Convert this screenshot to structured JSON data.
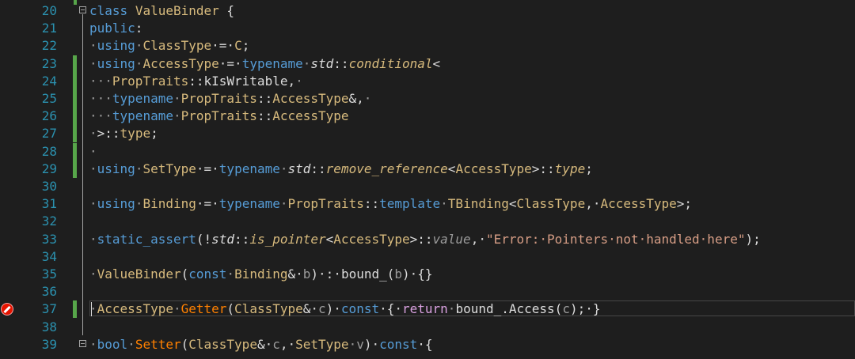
{
  "colors": {
    "background": "#1e1e1e",
    "line_number": "#2b91af",
    "change_bar": "#57a64a",
    "breakpoint": "#e51400",
    "keyword": "#569cd6",
    "type": "#4ec9b0",
    "string": "#d69d85",
    "function": "#dcdcaa"
  },
  "editor": {
    "lines": [
      {
        "num": "20",
        "tokens": [
          {
            "t": "class",
            "c": "t-kw"
          },
          {
            "t": " ",
            "c": "t-plain"
          },
          {
            "t": "ValueBinder",
            "c": "t-yellow"
          },
          {
            "t": " {",
            "c": "t-plain"
          }
        ]
      },
      {
        "num": "21",
        "tokens": [
          {
            "t": "public",
            "c": "t-kw"
          },
          {
            "t": ":",
            "c": "t-plain"
          }
        ]
      },
      {
        "num": "22",
        "tokens": [
          {
            "t": "·",
            "c": "t-gray"
          },
          {
            "t": "using",
            "c": "t-kw"
          },
          {
            "t": "·",
            "c": "t-gray"
          },
          {
            "t": "ClassType",
            "c": "t-yellow"
          },
          {
            "t": "·=·",
            "c": "t-plain"
          },
          {
            "t": "C",
            "c": "t-yellow"
          },
          {
            "t": ";",
            "c": "t-plain"
          }
        ]
      },
      {
        "num": "23",
        "tokens": [
          {
            "t": "·",
            "c": "t-gray"
          },
          {
            "t": "using",
            "c": "t-kw"
          },
          {
            "t": "·",
            "c": "t-gray"
          },
          {
            "t": "AccessType",
            "c": "t-yellow"
          },
          {
            "t": "·=·",
            "c": "t-plain"
          },
          {
            "t": "typename",
            "c": "t-kw"
          },
          {
            "t": "·",
            "c": "t-gray"
          },
          {
            "t": "std",
            "c": "t-ital"
          },
          {
            "t": "::",
            "c": "t-plain"
          },
          {
            "t": "conditional",
            "c": "t-ital t-yellow"
          },
          {
            "t": "<",
            "c": "t-plain"
          }
        ]
      },
      {
        "num": "24",
        "tokens": [
          {
            "t": "···",
            "c": "t-gray"
          },
          {
            "t": "PropTraits",
            "c": "t-yellow"
          },
          {
            "t": "::kIsWritable,",
            "c": "t-plain"
          },
          {
            "t": "·",
            "c": "t-gray"
          }
        ]
      },
      {
        "num": "25",
        "tokens": [
          {
            "t": "···",
            "c": "t-gray"
          },
          {
            "t": "typename",
            "c": "t-kw"
          },
          {
            "t": "·",
            "c": "t-gray"
          },
          {
            "t": "PropTraits",
            "c": "t-yellow"
          },
          {
            "t": "::",
            "c": "t-plain"
          },
          {
            "t": "AccessType",
            "c": "t-yellow"
          },
          {
            "t": "&,",
            "c": "t-plain"
          },
          {
            "t": "·",
            "c": "t-gray"
          }
        ]
      },
      {
        "num": "26",
        "tokens": [
          {
            "t": "···",
            "c": "t-gray"
          },
          {
            "t": "typename",
            "c": "t-kw"
          },
          {
            "t": "·",
            "c": "t-gray"
          },
          {
            "t": "PropTraits",
            "c": "t-yellow"
          },
          {
            "t": "::",
            "c": "t-plain"
          },
          {
            "t": "AccessType",
            "c": "t-yellow"
          }
        ]
      },
      {
        "num": "27",
        "tokens": [
          {
            "t": "·",
            "c": "t-gray"
          },
          {
            "t": ">::",
            "c": "t-plain"
          },
          {
            "t": "type",
            "c": "t-yellow"
          },
          {
            "t": ";",
            "c": "t-plain"
          }
        ]
      },
      {
        "num": "28",
        "tokens": [
          {
            "t": "·",
            "c": "t-gray"
          }
        ]
      },
      {
        "num": "29",
        "tokens": [
          {
            "t": "·",
            "c": "t-gray"
          },
          {
            "t": "using",
            "c": "t-kw"
          },
          {
            "t": "·",
            "c": "t-gray"
          },
          {
            "t": "SetType",
            "c": "t-yellow"
          },
          {
            "t": "·=·",
            "c": "t-plain"
          },
          {
            "t": "typename",
            "c": "t-kw"
          },
          {
            "t": "·",
            "c": "t-gray"
          },
          {
            "t": "std",
            "c": "t-ital"
          },
          {
            "t": "::",
            "c": "t-plain"
          },
          {
            "t": "remove_reference",
            "c": "t-ital t-yellow"
          },
          {
            "t": "<",
            "c": "t-plain"
          },
          {
            "t": "AccessType",
            "c": "t-yellow"
          },
          {
            "t": ">::",
            "c": "t-plain"
          },
          {
            "t": "type",
            "c": "t-ital t-yellow"
          },
          {
            "t": ";",
            "c": "t-plain"
          }
        ]
      },
      {
        "num": "30",
        "tokens": []
      },
      {
        "num": "31",
        "tokens": [
          {
            "t": "·",
            "c": "t-gray"
          },
          {
            "t": "using",
            "c": "t-kw"
          },
          {
            "t": "·",
            "c": "t-gray"
          },
          {
            "t": "Binding",
            "c": "t-yellow"
          },
          {
            "t": "·=·",
            "c": "t-plain"
          },
          {
            "t": "typename",
            "c": "t-kw"
          },
          {
            "t": "·",
            "c": "t-gray"
          },
          {
            "t": "PropTraits",
            "c": "t-yellow"
          },
          {
            "t": "::",
            "c": "t-plain"
          },
          {
            "t": "template",
            "c": "t-kw"
          },
          {
            "t": "·",
            "c": "t-gray"
          },
          {
            "t": "TBinding",
            "c": "t-yellow"
          },
          {
            "t": "<",
            "c": "t-plain"
          },
          {
            "t": "ClassType",
            "c": "t-yellow"
          },
          {
            "t": ",·",
            "c": "t-plain"
          },
          {
            "t": "AccessType",
            "c": "t-yellow"
          },
          {
            "t": ">;",
            "c": "t-plain"
          }
        ]
      },
      {
        "num": "32",
        "tokens": []
      },
      {
        "num": "33",
        "tokens": [
          {
            "t": "·",
            "c": "t-gray"
          },
          {
            "t": "static_assert",
            "c": "t-kw"
          },
          {
            "t": "(!",
            "c": "t-plain"
          },
          {
            "t": "std",
            "c": "t-ital"
          },
          {
            "t": "::",
            "c": "t-plain"
          },
          {
            "t": "is_pointer",
            "c": "t-ital t-yellow"
          },
          {
            "t": "<",
            "c": "t-plain"
          },
          {
            "t": "AccessType",
            "c": "t-yellow"
          },
          {
            "t": ">::",
            "c": "t-plain"
          },
          {
            "t": "value",
            "c": "t-ital t-gray"
          },
          {
            "t": ",·",
            "c": "t-plain"
          },
          {
            "t": "\"Error:·Pointers·not·handled·here\"",
            "c": "t-str"
          },
          {
            "t": ");",
            "c": "t-plain"
          }
        ]
      },
      {
        "num": "34",
        "tokens": []
      },
      {
        "num": "35",
        "tokens": [
          {
            "t": "·",
            "c": "t-gray"
          },
          {
            "t": "ValueBinder",
            "c": "t-yellow"
          },
          {
            "t": "(",
            "c": "t-plain"
          },
          {
            "t": "const",
            "c": "t-kw"
          },
          {
            "t": "·",
            "c": "t-gray"
          },
          {
            "t": "Binding",
            "c": "t-yellow"
          },
          {
            "t": "&·",
            "c": "t-plain"
          },
          {
            "t": "b",
            "c": "t-gray"
          },
          {
            "t": ")·:·",
            "c": "t-plain"
          },
          {
            "t": "bound_",
            "c": "t-plain"
          },
          {
            "t": "(",
            "c": "t-plain"
          },
          {
            "t": "b",
            "c": "t-gray"
          },
          {
            "t": ")·{}",
            "c": "t-plain"
          }
        ]
      },
      {
        "num": "36",
        "tokens": []
      },
      {
        "num": "37",
        "tokens": [
          {
            "t": "·",
            "c": "t-gray"
          },
          {
            "t": "AccessType",
            "c": "t-yellow"
          },
          {
            "t": "·",
            "c": "t-gray"
          },
          {
            "t": "Getter",
            "c": "t-orange"
          },
          {
            "t": "(",
            "c": "t-plain"
          },
          {
            "t": "ClassType",
            "c": "t-yellow"
          },
          {
            "t": "&·",
            "c": "t-plain"
          },
          {
            "t": "c",
            "c": "t-gray"
          },
          {
            "t": ")·",
            "c": "t-plain"
          },
          {
            "t": "const",
            "c": "t-kw"
          },
          {
            "t": "·{·",
            "c": "t-plain"
          },
          {
            "t": "return",
            "c": "t-purple"
          },
          {
            "t": "·",
            "c": "t-gray"
          },
          {
            "t": "bound_",
            "c": "t-plain"
          },
          {
            "t": ".",
            "c": "t-plain"
          },
          {
            "t": "Access",
            "c": "t-plain"
          },
          {
            "t": "(",
            "c": "t-plain"
          },
          {
            "t": "c",
            "c": "t-gray"
          },
          {
            "t": ");·}",
            "c": "t-plain"
          }
        ]
      },
      {
        "num": "38",
        "tokens": []
      },
      {
        "num": "39",
        "tokens": [
          {
            "t": "·",
            "c": "t-gray"
          },
          {
            "t": "bool",
            "c": "t-kw"
          },
          {
            "t": "·",
            "c": "t-gray"
          },
          {
            "t": "Setter",
            "c": "t-orange"
          },
          {
            "t": "(",
            "c": "t-plain"
          },
          {
            "t": "ClassType",
            "c": "t-yellow"
          },
          {
            "t": "&·",
            "c": "t-plain"
          },
          {
            "t": "c",
            "c": "t-gray"
          },
          {
            "t": ",·",
            "c": "t-plain"
          },
          {
            "t": "SetType",
            "c": "t-yellow"
          },
          {
            "t": "·",
            "c": "t-gray"
          },
          {
            "t": "v",
            "c": "t-gray"
          },
          {
            "t": ")·",
            "c": "t-plain"
          },
          {
            "t": "const",
            "c": "t-kw"
          },
          {
            "t": "·{",
            "c": "t-plain"
          }
        ]
      }
    ]
  },
  "markers": {
    "change_lines": [
      "23",
      "24",
      "25",
      "26",
      "27",
      "28",
      "29",
      "37"
    ],
    "fold_lines": [
      "20",
      "39"
    ],
    "breakpoint_line": "37",
    "selected_line": "37"
  }
}
